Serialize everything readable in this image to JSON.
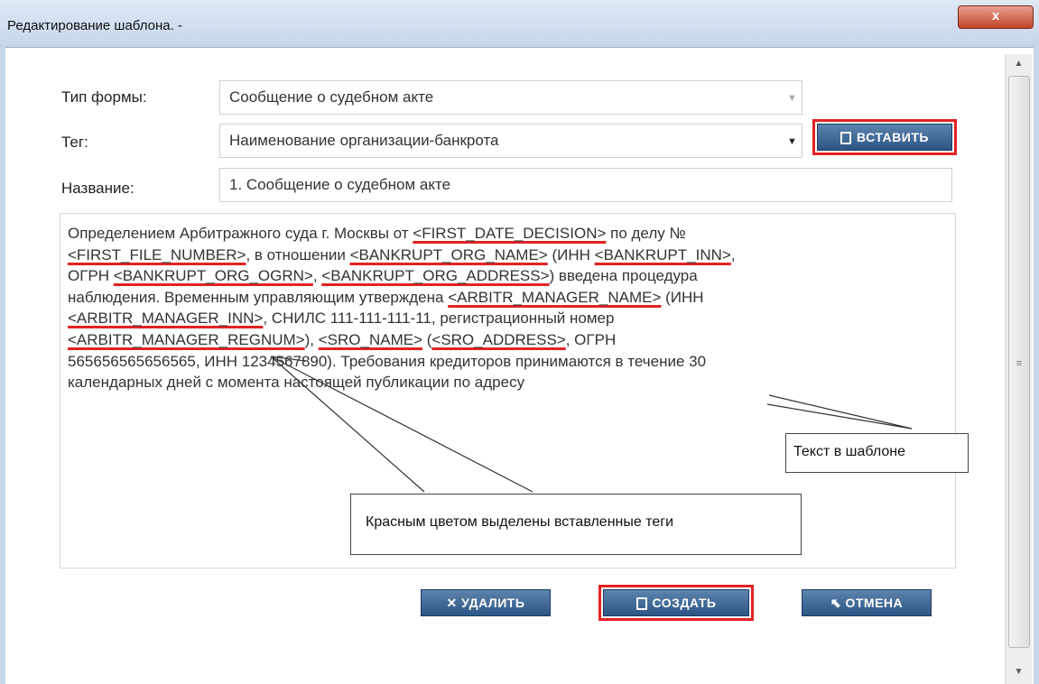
{
  "window": {
    "title": "Редактирование шаблона. -",
    "close_label": "x"
  },
  "form": {
    "type_label": "Тип формы:",
    "type_value": "Сообщение о судебном акте",
    "tag_label": "Тег:",
    "tag_value": "Наименование организации-банкрота",
    "insert_label": "ВСТАВИТЬ",
    "name_label": "Название:",
    "name_value": "1. Сообщение о судебном акте"
  },
  "template_text": {
    "t01": "Определением Арбитражного суда г. Москвы от ",
    "k01": "<FIRST_DATE_DECISION>",
    "t02": " по делу №",
    "k02": "<FIRST_FILE_NUMBER>",
    "t03": ", в отношении ",
    "k03": "<BANKRUPT_ORG_NAME>",
    "t04": " (ИНН ",
    "k04": "<BANKRUPT_INN>",
    "t05": ",",
    "t06": "ОГРН ",
    "k05": "<BANKRUPT_ORG_OGRN>",
    "t07": ", ",
    "k06": "<BANKRUPT_ORG_ADDRESS>",
    "t08": ") введена процедура",
    "t09": "наблюдения. Временным управляющим утверждена ",
    "k07": "<ARBITR_MANAGER_NAME>",
    "t10": " (ИНН",
    "k08": "<ARBITR_MANAGER_INN>",
    "t11": ", СНИЛС 111-111-111-11, регистрационный номер",
    "k09": "<ARBITR_MANAGER_REGNUM>",
    "t12": "), ",
    "k10": "<SRO_NAME>",
    "t13": "  (",
    "k11": "<SRO_ADDRESS>",
    "t14": ", ОГРН",
    "t15": "565656565656565, ИНН 1234567890). Требования кредиторов принимаются в течение 30",
    "t16": "календарных дней с момента настоящей публикации по адресу"
  },
  "callouts": {
    "template_text": "Текст в шаблоне",
    "red_tags": "Красным цветом выделены вставленные теги"
  },
  "buttons": {
    "delete": "УДАЛИТЬ",
    "create": "СОЗДАТЬ",
    "cancel": "ОТМЕНА"
  },
  "colors": {
    "highlight": "#e32222",
    "button": "#2c5584"
  }
}
